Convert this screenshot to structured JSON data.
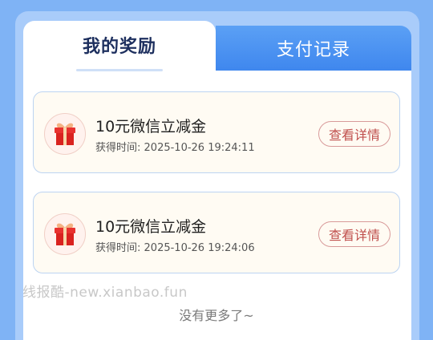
{
  "tabs": {
    "active_label": "我的奖励",
    "inactive_label": "支付记录"
  },
  "rewards": [
    {
      "title": "10元微信立减金",
      "time_label": "获得时间:",
      "time": "2025-10-26 19:24:11",
      "button_label": "查看详情",
      "icon": "gift-box-icon"
    },
    {
      "title": "10元微信立减金",
      "time_label": "获得时间:",
      "time": "2025-10-26 19:24:06",
      "button_label": "查看详情",
      "icon": "gift-box-icon"
    }
  ],
  "watermark": "线报酷-new.xianbao.fun",
  "end_text": "没有更多了~",
  "colors": {
    "background": "#7fb3f5",
    "tab_active_text": "#1d2f5e",
    "tab_inactive_bg": "#4a8ff0",
    "button_accent": "#c0504d"
  }
}
